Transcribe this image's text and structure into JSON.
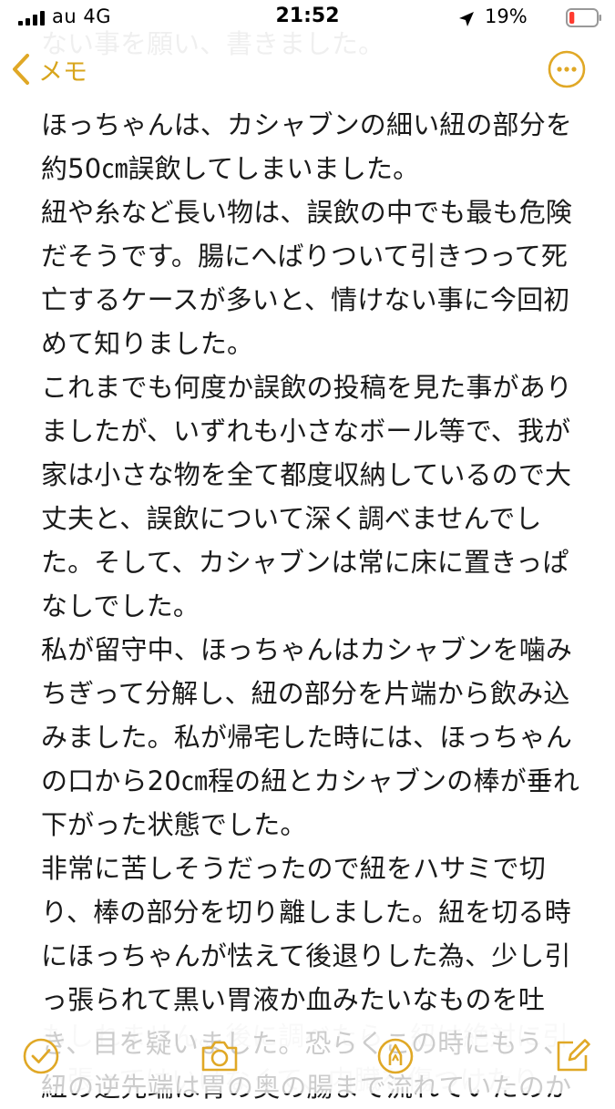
{
  "status_bar": {
    "carrier": "au  4G",
    "time": "21:52",
    "battery_percent": "19%",
    "battery_level": 0.19,
    "icons": [
      "signal-bars-icon",
      "location-arrow-icon",
      "battery-low-icon"
    ]
  },
  "nav": {
    "back_label": "メモ",
    "icons": [
      "chevron-left-icon",
      "more-ellipsis-icon"
    ]
  },
  "ghost_top": "ない事を願い、書きました。",
  "note": {
    "lines": [
      "ほっちゃんは、カシャブンの細い紐の部分を",
      "約50㎝誤飲してしまいました。",
      "紐や糸など長い物は、誤飲の中でも最も危険",
      "だそうです。腸にへばりついて引きつって死",
      "亡するケースが多いと、情けない事に今回初",
      "めて知りました。",
      "これまでも何度か誤飲の投稿を見た事があり",
      "ましたが、いずれも小さなボール等で、我が",
      "家は小さな物を全て都度収納しているので大",
      "丈夫と、誤飲について深く調べませんでし",
      "た。そして、カシャブンは常に床に置きっぱ",
      "なしでした。",
      "私が留守中、ほっちゃんはカシャブンを噛み",
      "ちぎって分解し、紐の部分を片端から飲み込",
      "みました。私が帰宅した時には、ほっちゃん",
      "の口から20㎝程の紐とカシャブンの棒が垂れ",
      "下がった状態でした。",
      "非常に苦しそうだったので紐をハサミで切",
      "り、棒の部分を切り離しました。紐を切る時",
      "にほっちゃんが怯えて後退りした為、少し引",
      "っ張られて黒い胃液か血みたいなものを吐",
      "き、目を疑いました。恐らくこの時にもう、",
      "紐の逆先端は胃の奥の腸まで流れていたのか"
    ]
  },
  "ghost_bottom": [
    "もしれません。後に調べたら、紐は絶対に引",
    "っ張ってはいけなくて、内臓を傷つけたり"
  ],
  "toolbar": {
    "icons": [
      "checklist-icon",
      "camera-icon",
      "markup-pen-icon",
      "compose-icon"
    ]
  },
  "colors": {
    "accent": "#E0A826",
    "battery_low": "#FF3B30",
    "text": "#1A1A1A"
  }
}
